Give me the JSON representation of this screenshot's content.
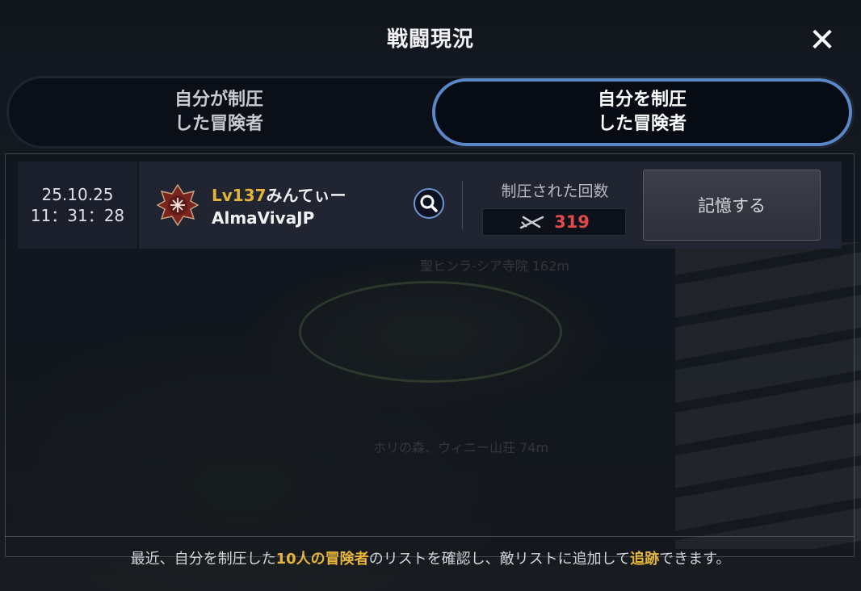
{
  "header": {
    "title": "戦闘現況",
    "close_label": "✕"
  },
  "tabs": [
    {
      "label": "自分が制圧\nした冒険者",
      "active": false
    },
    {
      "label": "自分を制圧\nした冒険者",
      "active": true
    }
  ],
  "record": {
    "date": "25.10.25",
    "time": "11：31：28",
    "level": "Lv137",
    "name": "みんてぃー",
    "server": "AlmaVivaJP",
    "count_label": "制圧された回数",
    "count": "319",
    "remember_label": "記憶する"
  },
  "background_labels": {
    "upper": "聖ヒンラ-シア寺院 162m",
    "lower": "ホリの森、ウィニー山荘 74m"
  },
  "footer": {
    "part1": "最近、自分を制圧した",
    "highlight1": "10人の冒険者",
    "part2": "のリストを確認し、敵リストに追加して",
    "highlight2": "追跡",
    "part3": "できます。"
  },
  "colors": {
    "accent_blue": "#5b86c7",
    "level_gold": "#e3b33a",
    "count_red": "#e24a4a",
    "highlight_gold": "#e6b53a"
  }
}
